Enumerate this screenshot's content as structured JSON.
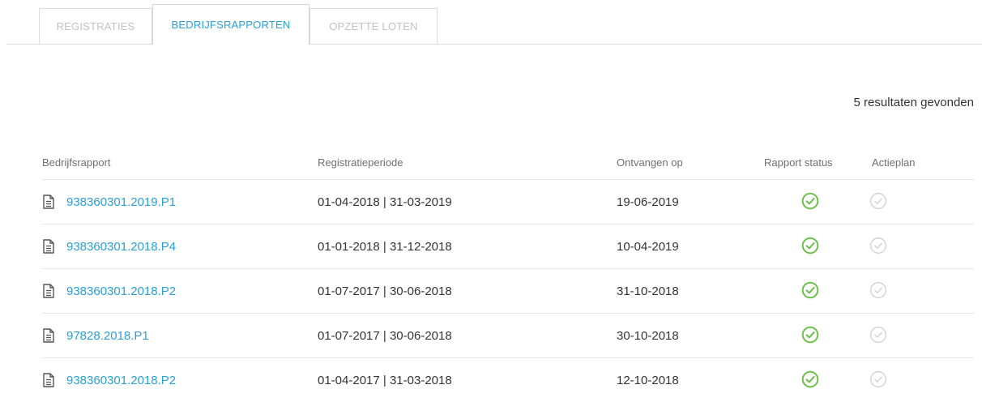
{
  "tabs": [
    {
      "label": "REGISTRATIES",
      "active": false
    },
    {
      "label": "BEDRIJFSRAPPORTEN",
      "active": true
    },
    {
      "label": "OPZETTE LOTEN",
      "active": false
    }
  ],
  "result_count": "5 resultaten gevonden",
  "table": {
    "headers": {
      "report": "Bedrijfsrapport",
      "period": "Registratieperiode",
      "received": "Ontvangen op",
      "status": "Rapport status",
      "actionplan": "Actieplan"
    },
    "rows": [
      {
        "report": "938360301.2019.P1",
        "period": "01-04-2018 | 31-03-2019",
        "received": "19-06-2019",
        "status_icon": "check-circle-icon",
        "actionplan_icon": "check-circle-outline-icon"
      },
      {
        "report": "938360301.2018.P4",
        "period": "01-01-2018 | 31-12-2018",
        "received": "10-04-2019",
        "status_icon": "check-circle-icon",
        "actionplan_icon": "check-circle-outline-icon"
      },
      {
        "report": "938360301.2018.P2",
        "period": "01-07-2017 | 30-06-2018",
        "received": "31-10-2018",
        "status_icon": "check-circle-icon",
        "actionplan_icon": "check-circle-outline-icon"
      },
      {
        "report": "97828.2018.P1",
        "period": "01-07-2017 | 30-06-2018",
        "received": "30-10-2018",
        "status_icon": "check-circle-icon",
        "actionplan_icon": "check-circle-outline-icon"
      },
      {
        "report": "938360301.2018.P2",
        "period": "01-04-2017 | 31-03-2018",
        "received": "12-10-2018",
        "status_icon": "check-circle-icon",
        "actionplan_icon": "check-circle-outline-icon"
      }
    ]
  },
  "colors": {
    "accent": "#2a9fd8",
    "status_ok": "#6cc04a",
    "inactive": "#cfcfcf"
  }
}
